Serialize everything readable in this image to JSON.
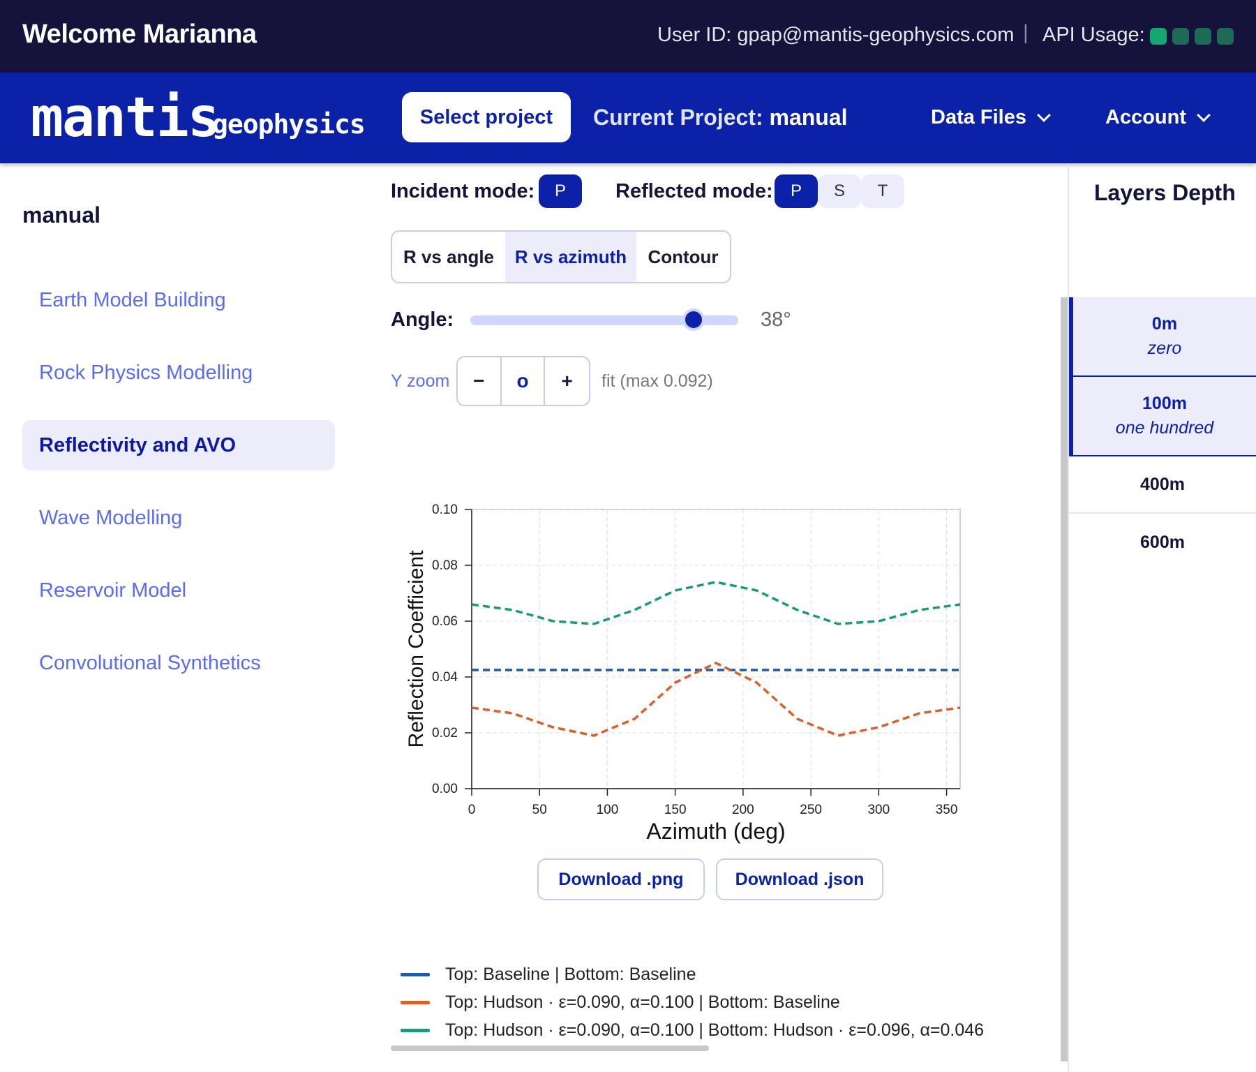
{
  "topbar": {
    "welcome": "Welcome Marianna",
    "user_id": "User ID: gpap@mantis-geophysics.com",
    "separator": "|",
    "api_usage_label": "API Usage:",
    "api_usage_levels": 4,
    "api_usage_active_color": "#12a870",
    "api_usage_inactive_color": "#1d6b56"
  },
  "navbar": {
    "logo_main": "mantis",
    "logo_sub": "geophysics",
    "select_project": "Select project",
    "current_project_label": "Current Project:",
    "current_project_value": "manual",
    "data_files": "Data Files",
    "account": "Account",
    "brand_color": "#0b22a8"
  },
  "sidebar": {
    "project": "manual",
    "items": [
      {
        "label": "Earth Model Building",
        "active": false
      },
      {
        "label": "Rock Physics Modelling",
        "active": false
      },
      {
        "label": "Reflectivity and AVO",
        "active": true
      },
      {
        "label": "Wave Modelling",
        "active": false
      },
      {
        "label": "Reservoir Model",
        "active": false
      },
      {
        "label": "Convolutional Synthetics",
        "active": false
      }
    ]
  },
  "controls": {
    "incident_label": "Incident mode:",
    "incident_options": [
      "P"
    ],
    "incident_selected": "P",
    "reflected_label": "Reflected mode:",
    "reflected_options": [
      "P",
      "S",
      "T"
    ],
    "reflected_selected": "P",
    "view_tabs": [
      "R vs angle",
      "R vs azimuth",
      "Contour"
    ],
    "view_selected": "R vs azimuth",
    "angle_label": "Angle:",
    "angle_value": "38°",
    "angle_fraction": 0.84,
    "yzoom_label": "Y zoom",
    "zoom_minus": "−",
    "zoom_reset": "o",
    "zoom_plus": "+",
    "fit_text": "fit (max 0.092)"
  },
  "chart_data": {
    "type": "line",
    "xlabel": "Azimuth (deg)",
    "ylabel": "Reflection Coefficient",
    "xlim": [
      0,
      360
    ],
    "ylim": [
      0,
      0.1
    ],
    "xticks": [
      "0",
      "50",
      "100",
      "150",
      "200",
      "250",
      "300",
      "350"
    ],
    "yticks": [
      "0.00",
      "0.02",
      "0.04",
      "0.06",
      "0.08",
      "0.10"
    ],
    "grid": true,
    "x": [
      0,
      30,
      60,
      90,
      120,
      150,
      180,
      210,
      240,
      270,
      300,
      330,
      360
    ],
    "series": [
      {
        "name": "Top: Baseline | Bottom: Baseline",
        "color": "#1f5aa6",
        "values": [
          0.0425,
          0.0425,
          0.0425,
          0.0425,
          0.0425,
          0.0425,
          0.0425,
          0.0425,
          0.0425,
          0.0425,
          0.0425,
          0.0425,
          0.0425
        ]
      },
      {
        "name": "Top: Hudson · ε=0.090, α=0.100 | Bottom: Baseline",
        "color": "#d9622b",
        "values": [
          0.029,
          0.027,
          0.022,
          0.019,
          0.025,
          0.038,
          0.045,
          0.038,
          0.025,
          0.019,
          0.022,
          0.027,
          0.029
        ]
      },
      {
        "name": "Top: Hudson · ε=0.090, α=0.100 | Bottom: Hudson · ε=0.096, α=0.046",
        "color": "#1e9a78",
        "values": [
          0.066,
          0.064,
          0.06,
          0.059,
          0.064,
          0.071,
          0.074,
          0.071,
          0.064,
          0.059,
          0.06,
          0.064,
          0.066
        ]
      }
    ]
  },
  "downloads": {
    "png": "Download .png",
    "json": "Download .json"
  },
  "layers": {
    "title": "Layers Depth",
    "items": [
      {
        "depth": "0m",
        "name": "zero"
      },
      {
        "depth": "100m",
        "name": "one hundred"
      },
      {
        "depth": "400m",
        "name": ""
      },
      {
        "depth": "600m",
        "name": ""
      }
    ]
  }
}
